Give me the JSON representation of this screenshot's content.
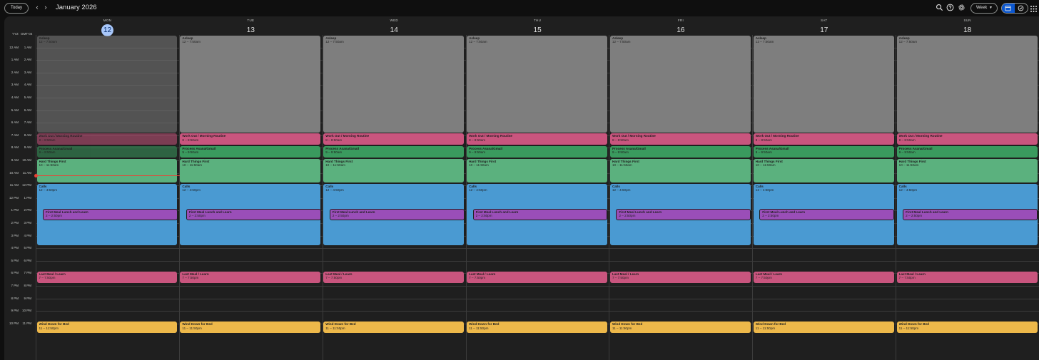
{
  "toolbar": {
    "today_label": "Today",
    "prev_label": "‹",
    "next_label": "›",
    "month_title": "January 2026",
    "view_label": "Week",
    "icons": [
      "search-icon",
      "help-icon",
      "settings-icon",
      "calendar-view-icon",
      "tasks-view-icon",
      "apps-grid-icon"
    ]
  },
  "timezones": {
    "primary": "YYZ",
    "secondary": "GMT-04"
  },
  "days": [
    {
      "dow": "MON",
      "date": "12",
      "today": true
    },
    {
      "dow": "TUE",
      "date": "13",
      "today": false
    },
    {
      "dow": "WED",
      "date": "14",
      "today": false
    },
    {
      "dow": "THU",
      "date": "15",
      "today": false
    },
    {
      "dow": "FRI",
      "date": "16",
      "today": false
    },
    {
      "dow": "SAT",
      "date": "17",
      "today": false
    },
    {
      "dow": "SUN",
      "date": "18",
      "today": false
    }
  ],
  "hours_primary": [
    "12 AM",
    "1 AM",
    "2 AM",
    "3 AM",
    "4 AM",
    "5 AM",
    "6 AM",
    "7 AM",
    "8 AM",
    "9 AM",
    "10 AM",
    "11 AM",
    "12 PM",
    "1 PM",
    "2 PM",
    "3 PM",
    "4 PM",
    "5 PM",
    "6 PM",
    "7 PM",
    "8 PM",
    "9 PM",
    "10 PM"
  ],
  "hours_secondary": [
    "1 AM",
    "2 AM",
    "3 AM",
    "4 AM",
    "5 AM",
    "6 AM",
    "7 AM",
    "8 AM",
    "9 AM",
    "10 AM",
    "11 AM",
    "12 PM",
    "1 PM",
    "2 PM",
    "3 PM",
    "4 PM",
    "5 PM",
    "6 PM",
    "7 PM",
    "8 PM",
    "9 PM",
    "10 PM",
    "11 PM"
  ],
  "events": [
    {
      "title": "Asleep",
      "time": "12 – 7:50am",
      "color": "#7e7e7e",
      "start": 0,
      "end": 7.83
    },
    {
      "title": "Work Out / Morning Routine",
      "time": "8 – 8:50am",
      "color": "#c9557e",
      "start": 7.83,
      "end": 8.83
    },
    {
      "title": "Process Asana/Gmail",
      "time": "9 – 9:50am",
      "color": "#3a9a5e",
      "start": 8.83,
      "end": 9.83
    },
    {
      "title": "Hard Things First",
      "time": "10 – 11:50am",
      "color": "#5bb17e",
      "start": 9.83,
      "end": 11.83
    },
    {
      "title": "Calls",
      "time": "12 – 4:50pm",
      "color": "#4a9ad2",
      "start": 11.83,
      "end": 16.83
    },
    {
      "title": "First Meal Lunch and Learn",
      "time": "2 – 2:50pm",
      "color": "#9a4eb8",
      "start": 13.83,
      "end": 14.83
    },
    {
      "title": "Last Meal / Learn",
      "time": "7 – 7:50pm",
      "color": "#c9557e",
      "start": 18.83,
      "end": 19.83
    },
    {
      "title": "Wind Down for Bed",
      "time": "11 – 11:50pm",
      "color": "#edb84a",
      "start": 22.83,
      "end": 23.83
    }
  ]
}
